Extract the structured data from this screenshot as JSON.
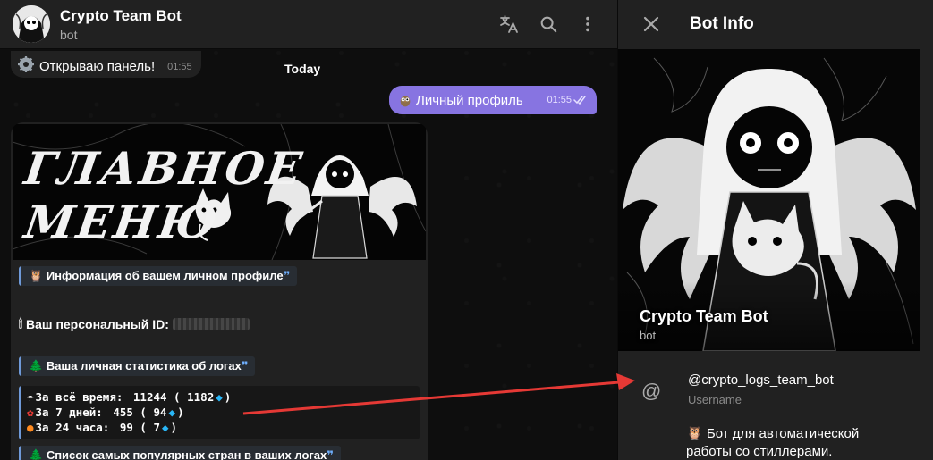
{
  "chat": {
    "title": "Crypto Team Bot",
    "subtitle": "bot",
    "header_icons": [
      "translate-icon",
      "search-icon",
      "more-vertical-icon"
    ],
    "system_message": {
      "icon": "gear-icon",
      "text": "Открываю панель!",
      "time": "01:55"
    },
    "date_label": "Today",
    "outgoing_message": {
      "icon": "owl-icon",
      "text": "Личный профиль",
      "time": "01:55",
      "status": "read"
    },
    "bot_message": {
      "banner": {
        "line1": "ГЛАВНОЕ",
        "line2": "МЕНЮ"
      },
      "profile_info_quote": "Информация об вашем личном профиле",
      "personal_id_label": "Ваш персональный ID:",
      "stats_quote": "Ваша личная статистика об логах",
      "stats": [
        {
          "icon": "umbrella-icon",
          "label": "За всё время:",
          "value": "11244 ( 1182",
          "suffix": ")"
        },
        {
          "icon": "maple-leaf-icon",
          "label": "За 7 дней:",
          "value": "455 ( 94",
          "suffix": ")"
        },
        {
          "icon": "pumpkin-icon",
          "label": "За 24 часа:",
          "value": "99 ( 7",
          "suffix": ")"
        }
      ],
      "countries_quote": "Список самых популярных стран в ваших логах"
    }
  },
  "info": {
    "title": "Bot Info",
    "name": "Crypto Team Bot",
    "name_sub": "bot",
    "username": "@crypto_logs_team_bot",
    "username_label": "Username",
    "about_line1": "Бот для автоматической",
    "about_line2": "работы со стиллерами."
  },
  "colors": {
    "accent": "#8774e1",
    "quote_border": "#6f9ad9",
    "arrow": "#e53935",
    "panel": "#212121"
  }
}
